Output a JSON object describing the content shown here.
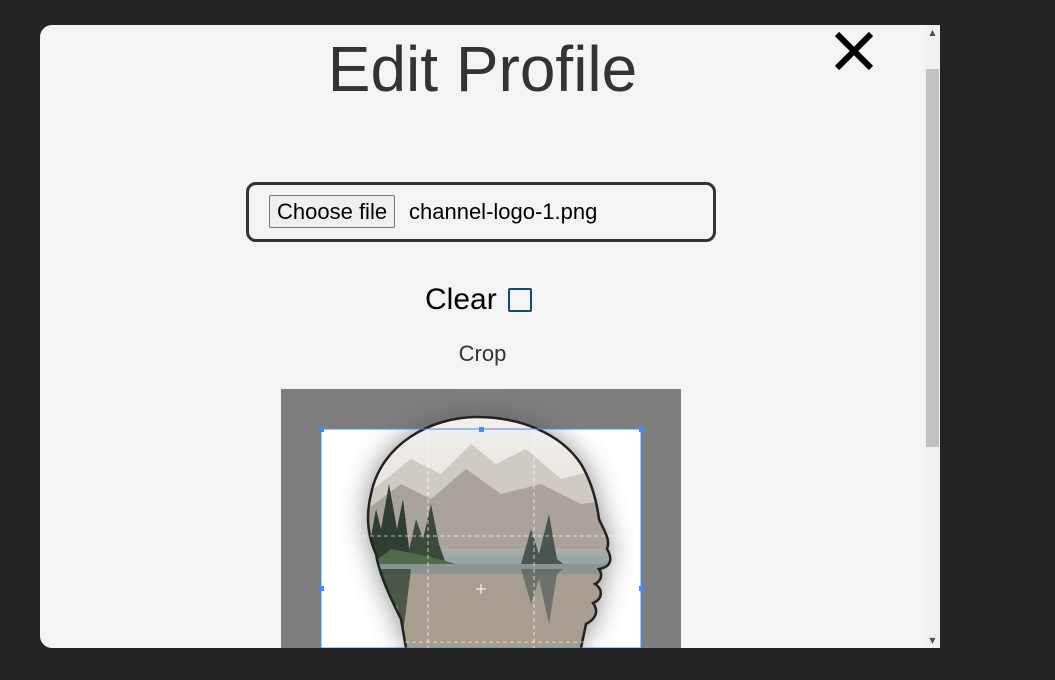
{
  "modal": {
    "title": "Edit Profile",
    "close_icon": "close-icon"
  },
  "file_input": {
    "button_label": "Choose file",
    "file_name": "channel-logo-1.png"
  },
  "clear": {
    "label": "Clear",
    "checked": false
  },
  "crop": {
    "label": "Crop",
    "image_description": "head-silhouette-landscape"
  },
  "colors": {
    "page_bg": "#232323",
    "modal_bg": "#f4f4f4",
    "title_text": "#333333",
    "crop_backdrop": "#7e7e7e",
    "crop_outline": "#3d8dff",
    "checkbox_border": "#0f4d6b"
  }
}
